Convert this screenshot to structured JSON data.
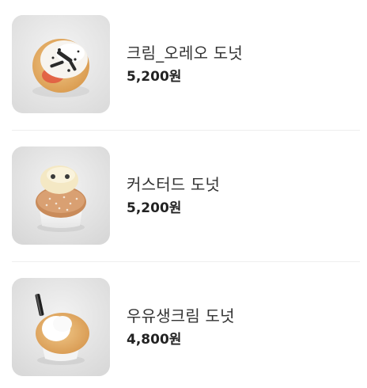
{
  "menu": {
    "items": [
      {
        "name": "크림_오레오 도넛",
        "price": "5,200원",
        "image_icon": "cream-oreo-donut-image"
      },
      {
        "name": "커스터드 도넛",
        "price": "5,200원",
        "image_icon": "custard-donut-image"
      },
      {
        "name": "우유생크림 도넛",
        "price": "4,800원",
        "image_icon": "milk-cream-donut-image"
      }
    ]
  }
}
